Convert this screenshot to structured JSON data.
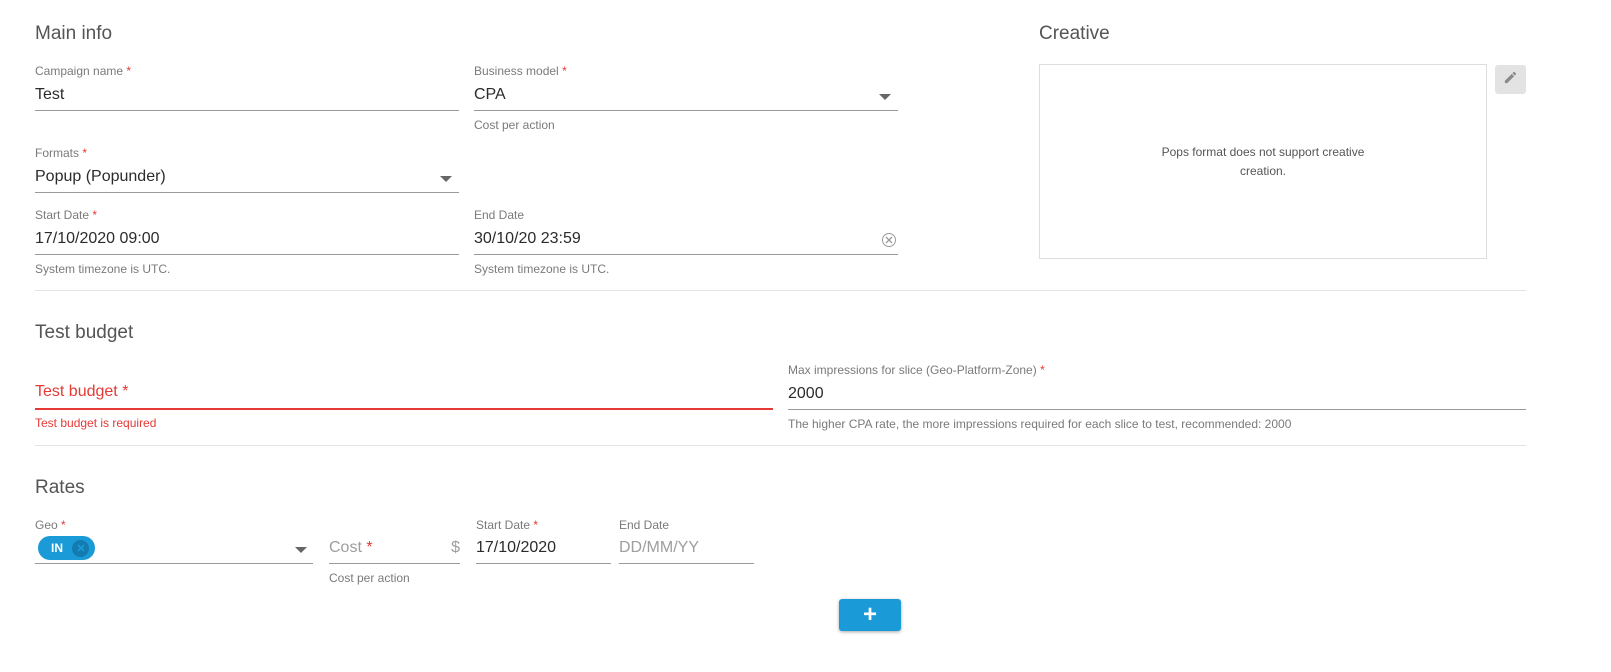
{
  "main_info": {
    "title": "Main info",
    "campaign_name": {
      "label": "Campaign name",
      "required": "*",
      "value": "Test"
    },
    "business_model": {
      "label": "Business model",
      "required": "*",
      "value": "CPA",
      "hint": "Cost per action"
    },
    "formats": {
      "label": "Formats",
      "required": "*",
      "value": "Popup (Popunder)"
    },
    "start_date": {
      "label": "Start Date",
      "required": "*",
      "value": "17/10/2020 09:00",
      "hint": "System timezone is UTC."
    },
    "end_date": {
      "label": "End Date",
      "value": "30/10/20 23:59",
      "hint": "System timezone is UTC."
    }
  },
  "creative": {
    "title": "Creative",
    "message": "Pops format does not support creative creation.",
    "edit_icon": "pencil-icon"
  },
  "test_budget": {
    "title": "Test budget",
    "budget": {
      "placeholder": "Test budget",
      "required": "*",
      "error": "Test budget is required"
    },
    "max_impressions": {
      "label": "Max impressions for slice (Geo-Platform-Zone)",
      "required": "*",
      "value": "2000",
      "hint": "The higher CPA rate, the more impressions required for each slice to test, recommended: 2000"
    }
  },
  "rates": {
    "title": "Rates",
    "geo": {
      "label": "Geo",
      "required": "*",
      "chip": "IN"
    },
    "cost": {
      "placeholder": "Cost",
      "required": "*",
      "currency": "$",
      "hint": "Cost per action"
    },
    "start_date": {
      "label": "Start Date",
      "required": "*",
      "value": "17/10/2020"
    },
    "end_date": {
      "label": "End Date",
      "placeholder": "DD/MM/YY"
    },
    "add_button": {
      "label": "+"
    }
  },
  "colors": {
    "accent": "#1a9bd7",
    "error": "#e53935",
    "chip_bg": "#1a9bd7"
  }
}
